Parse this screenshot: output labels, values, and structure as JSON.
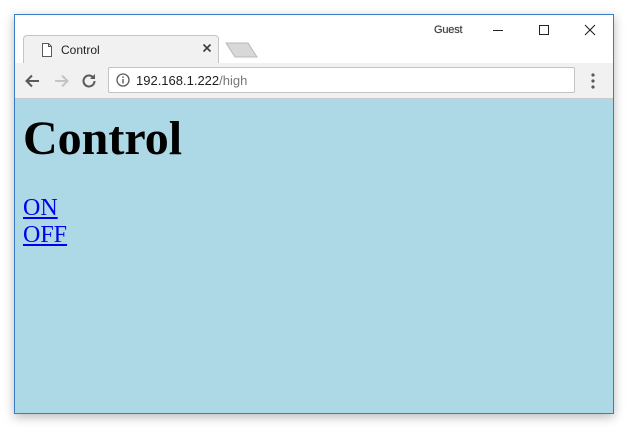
{
  "browser": {
    "tab_title": "Control",
    "profile_label": "Guest",
    "url_host": "192.168.1.222",
    "url_path": "/high",
    "tab_icon": "page-icon",
    "window_controls": [
      "minimize-icon",
      "maximize-icon",
      "close-icon"
    ],
    "toolbar_icons": [
      "back-arrow-icon",
      "forward-arrow-icon",
      "reload-icon",
      "info-icon",
      "menu-icon"
    ]
  },
  "page": {
    "heading": "Control",
    "links": [
      {
        "label": "ON"
      },
      {
        "label": "OFF"
      }
    ],
    "background_color": "#add8e6",
    "link_color": "#0000ee"
  }
}
